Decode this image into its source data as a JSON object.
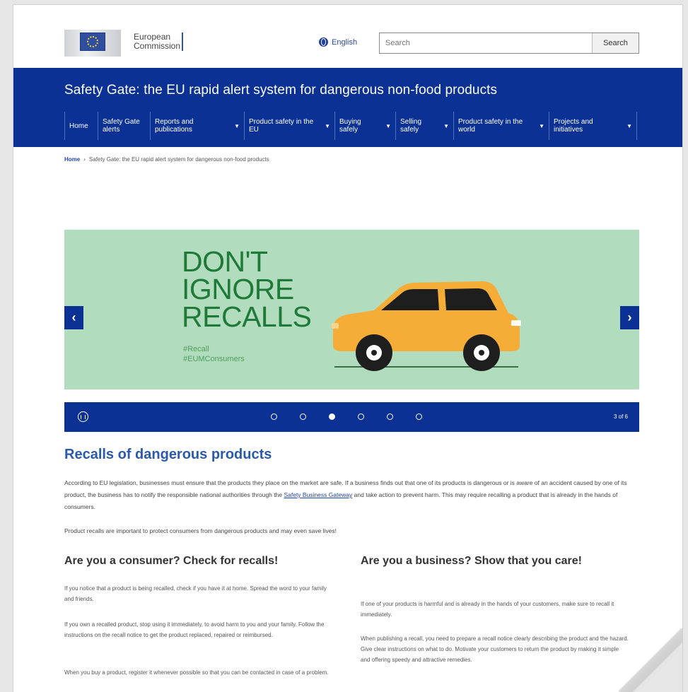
{
  "header": {
    "logo_text": "European Commission",
    "language": "English",
    "search_placeholder": "Search",
    "search_button": "Search"
  },
  "banner": {
    "title": "Safety Gate: the EU rapid alert system for dangerous non-food products",
    "nav": [
      {
        "label": "Home",
        "has_menu": false
      },
      {
        "label": "Safety Gate alerts",
        "has_menu": false
      },
      {
        "label": "Reports and publications",
        "has_menu": true
      },
      {
        "label": "Product safety in the EU",
        "has_menu": true
      },
      {
        "label": "Buying safely",
        "has_menu": true
      },
      {
        "label": "Selling safely",
        "has_menu": true
      },
      {
        "label": "Product safety in the world",
        "has_menu": true
      },
      {
        "label": "Projects and initiatives",
        "has_menu": true
      }
    ]
  },
  "breadcrumb": {
    "home": "Home",
    "current": "Safety Gate: the EU rapid alert system for dangerous non-food products"
  },
  "carousel": {
    "headline_lines": [
      "DON'T",
      "IGNORE",
      "RECALLS"
    ],
    "tag1": "#Recall",
    "tag2": "#EUMConsumers",
    "counter": "3 of 6",
    "total_slides": 6,
    "active_slide": 3,
    "colors": {
      "slide_bg": "#b1dcbd",
      "car": "#f5ad38",
      "headline": "#1f7a3a",
      "bar": "#0a3193"
    }
  },
  "content": {
    "title": "Recalls of dangerous products",
    "p1_before": "According to EU legislation, businesses must ensure that the products they place on the market are safe. If a business finds out that one of its products is dangerous or is aware of an accident caused by one of its product, the business has to notify the responsible national authorities through the ",
    "p1_link": "Safety Business Gateway",
    "p1_after": " and take action to prevent harm. This may require recalling a product that is already in the hands of consumers.",
    "p2": "Product recalls are important to protect consumers from dangerous products and may even save lives!",
    "consumer": {
      "heading": "Are you a consumer? Check for recalls!",
      "p1": "If you notice that a product is being recalled, check if you have it at home. Spread the word to your family and friends.",
      "p2": "If you own a recalled product, stop using it immediately, to avoid harm to you and your family. Follow the instructions on the recall notice to get the product replaced, repaired or reimbursed.",
      "p3": "When you buy a product, register it whenever possible so that you can be contacted in case of a problem."
    },
    "business": {
      "heading": "Are you a business? Show that you care!",
      "p1": "If one of your products is harmful and is already in the hands of your customers, make sure to recall it immediately.",
      "p2": "When publishing a recall, you need to prepare a recall notice clearly describing the product and the hazard. Give clear instructions on what to do. Motivate your customers to return the product by making it simple and offering speedy and attractive remedies."
    }
  }
}
